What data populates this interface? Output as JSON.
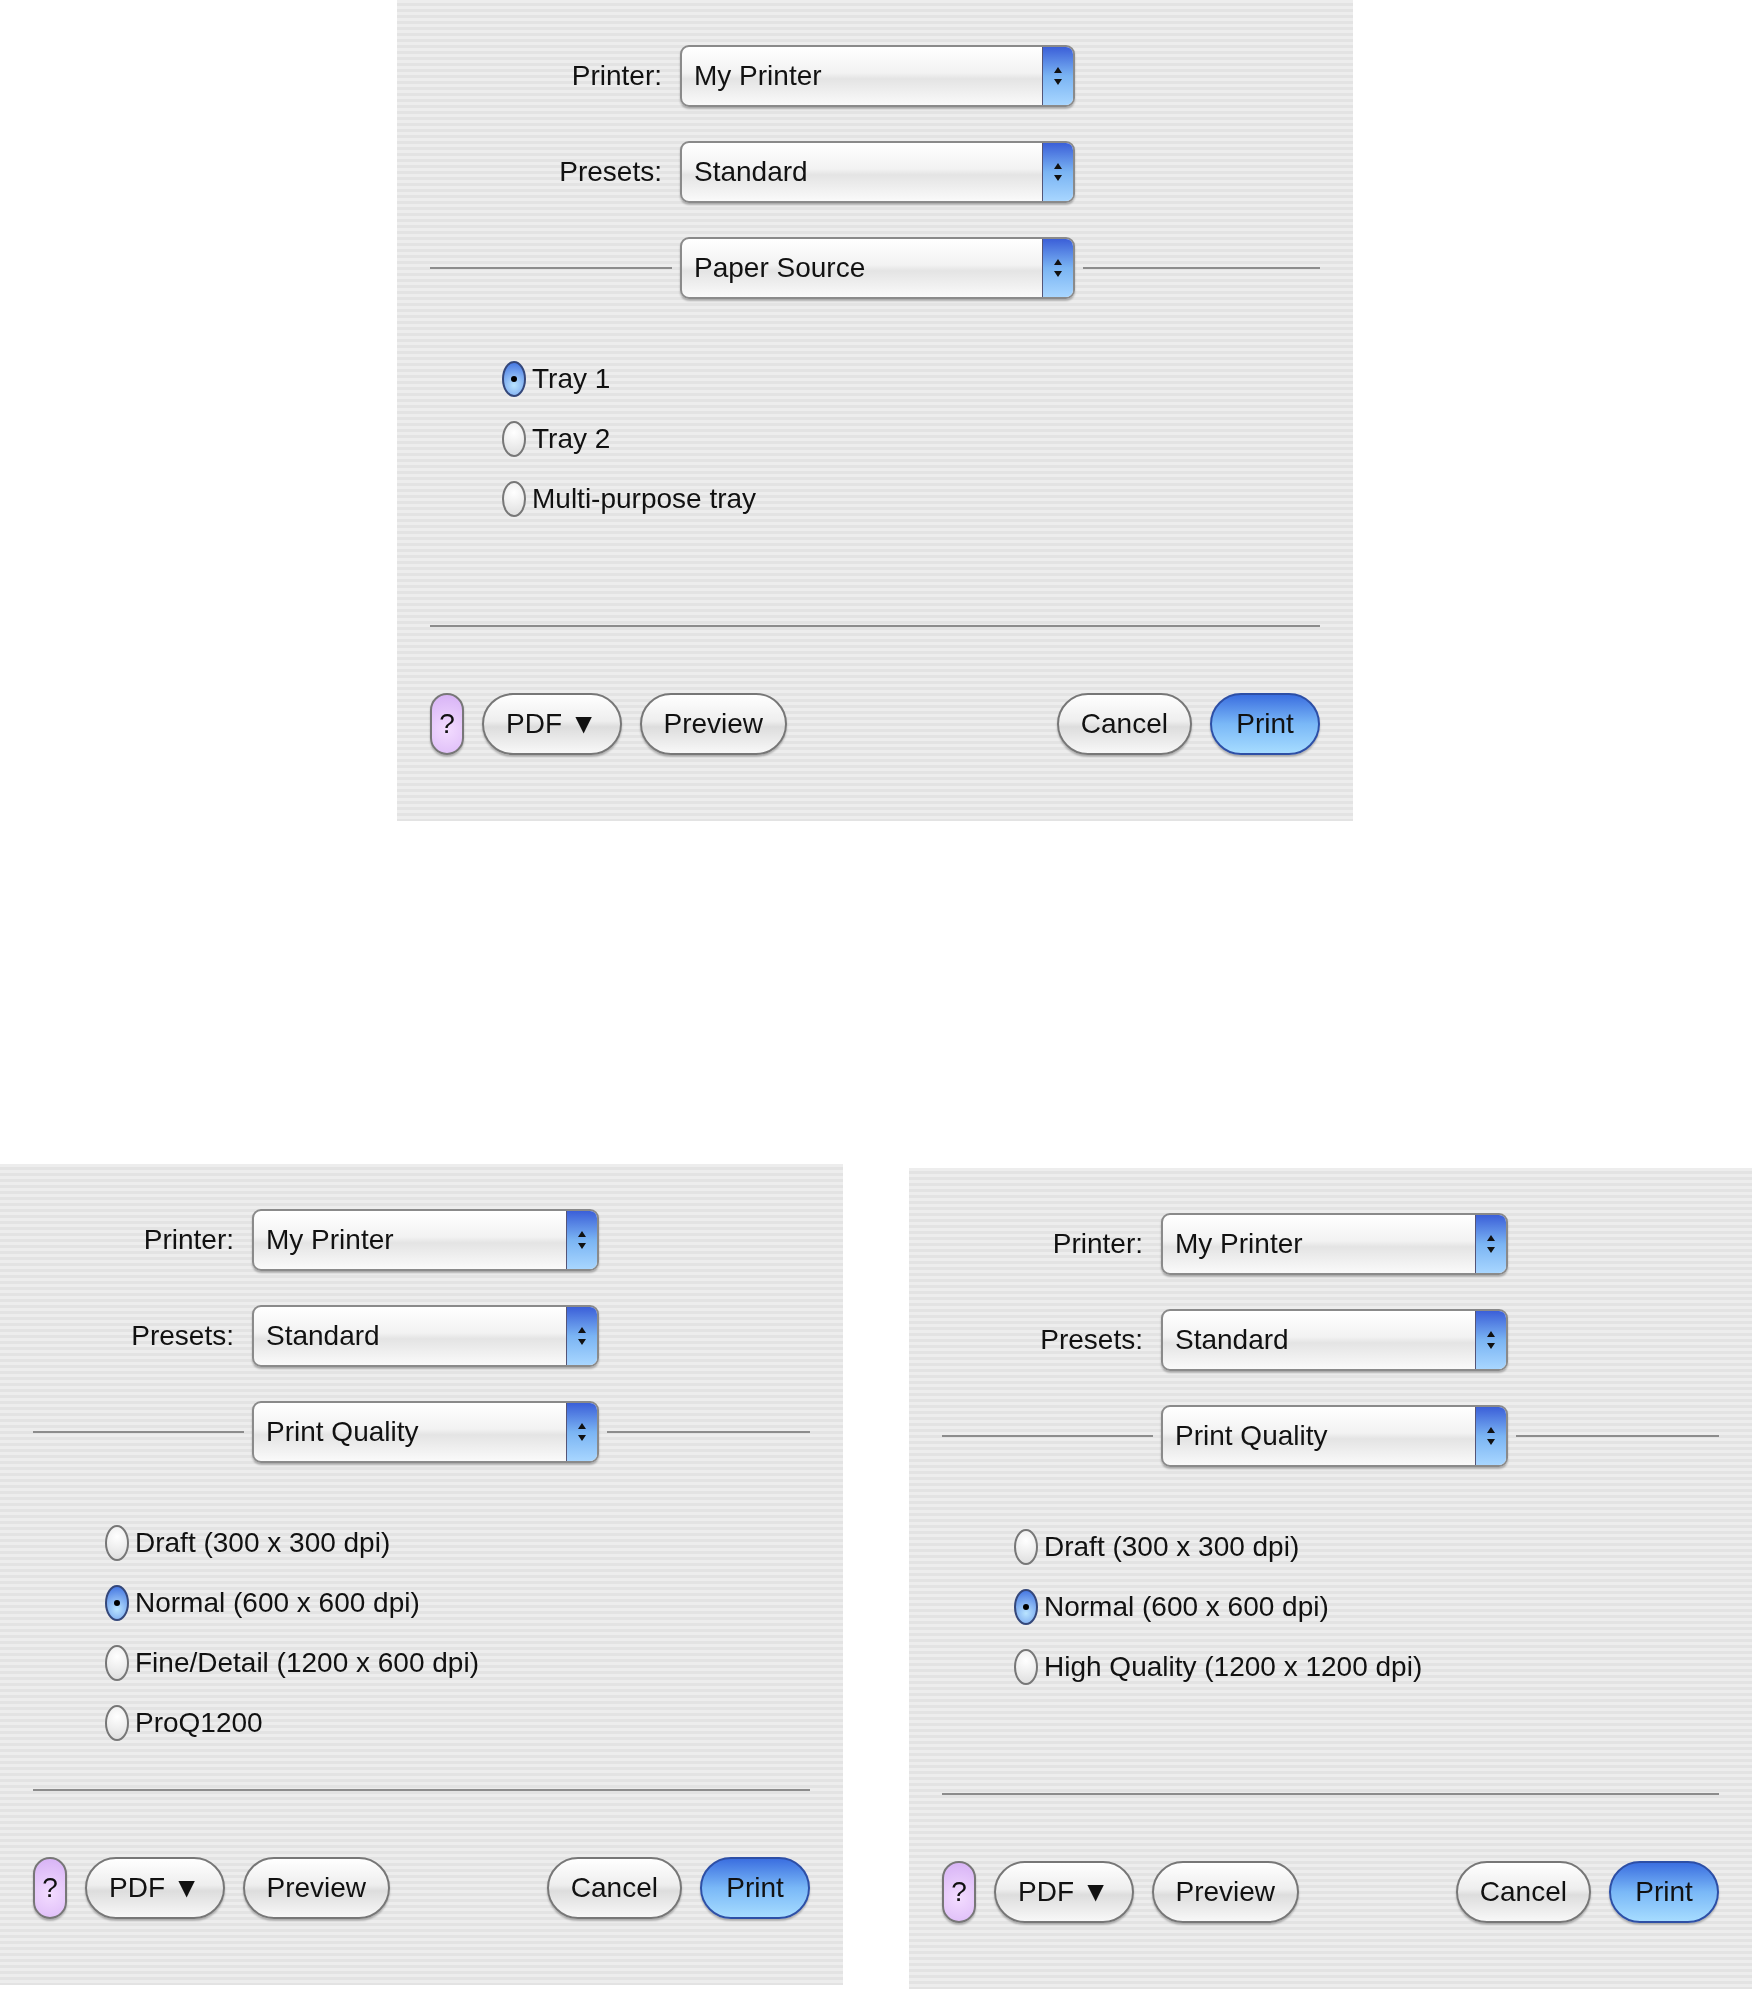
{
  "dialogs": [
    {
      "printer_label": "Printer:",
      "printer": "My Printer",
      "presets_label": "Presets:",
      "presets": "Standard",
      "panel": "Paper Source",
      "options": [
        {
          "label": "Tray 1",
          "selected": true
        },
        {
          "label": "Tray 2",
          "selected": false
        },
        {
          "label": "Multi-purpose tray",
          "selected": false
        }
      ],
      "left_buttons": [
        {
          "kind": "help",
          "label": "?"
        },
        {
          "kind": "menu",
          "label": "PDF ▼"
        },
        {
          "kind": "normal",
          "label": "Preview"
        }
      ],
      "right_buttons": [
        {
          "kind": "normal",
          "label": "Cancel"
        },
        {
          "kind": "default",
          "label": "Print"
        }
      ]
    },
    {
      "printer_label": "Printer:",
      "printer": "My Printer",
      "presets_label": "Presets:",
      "presets": "Standard",
      "panel": "Print Quality",
      "options": [
        {
          "label": "Draft (300 x 300 dpi)",
          "selected": false
        },
        {
          "label": "Normal (600 x 600 dpi)",
          "selected": true
        },
        {
          "label": "Fine/Detail (1200 x 600 dpi)",
          "selected": false
        },
        {
          "label": "ProQ1200",
          "selected": false
        }
      ],
      "left_buttons": [
        {
          "kind": "help",
          "label": "?"
        },
        {
          "kind": "menu",
          "label": "PDF ▼"
        },
        {
          "kind": "normal",
          "label": "Preview"
        }
      ],
      "right_buttons": [
        {
          "kind": "normal",
          "label": "Cancel"
        },
        {
          "kind": "default",
          "label": "Print"
        }
      ]
    },
    {
      "printer_label": "Printer:",
      "printer": "My Printer",
      "presets_label": "Presets:",
      "presets": "Standard",
      "panel": "Print Quality",
      "options": [
        {
          "label": "Draft (300 x 300 dpi)",
          "selected": false
        },
        {
          "label": "Normal (600 x 600 dpi)",
          "selected": true
        },
        {
          "label": "High Quality (1200 x 1200 dpi)",
          "selected": false
        }
      ],
      "left_buttons": [
        {
          "kind": "help",
          "label": "?"
        },
        {
          "kind": "menu",
          "label": "PDF ▼"
        },
        {
          "kind": "normal",
          "label": "Preview"
        }
      ],
      "right_buttons": [
        {
          "kind": "normal",
          "label": "Cancel"
        },
        {
          "kind": "default",
          "label": "Print"
        }
      ]
    }
  ]
}
